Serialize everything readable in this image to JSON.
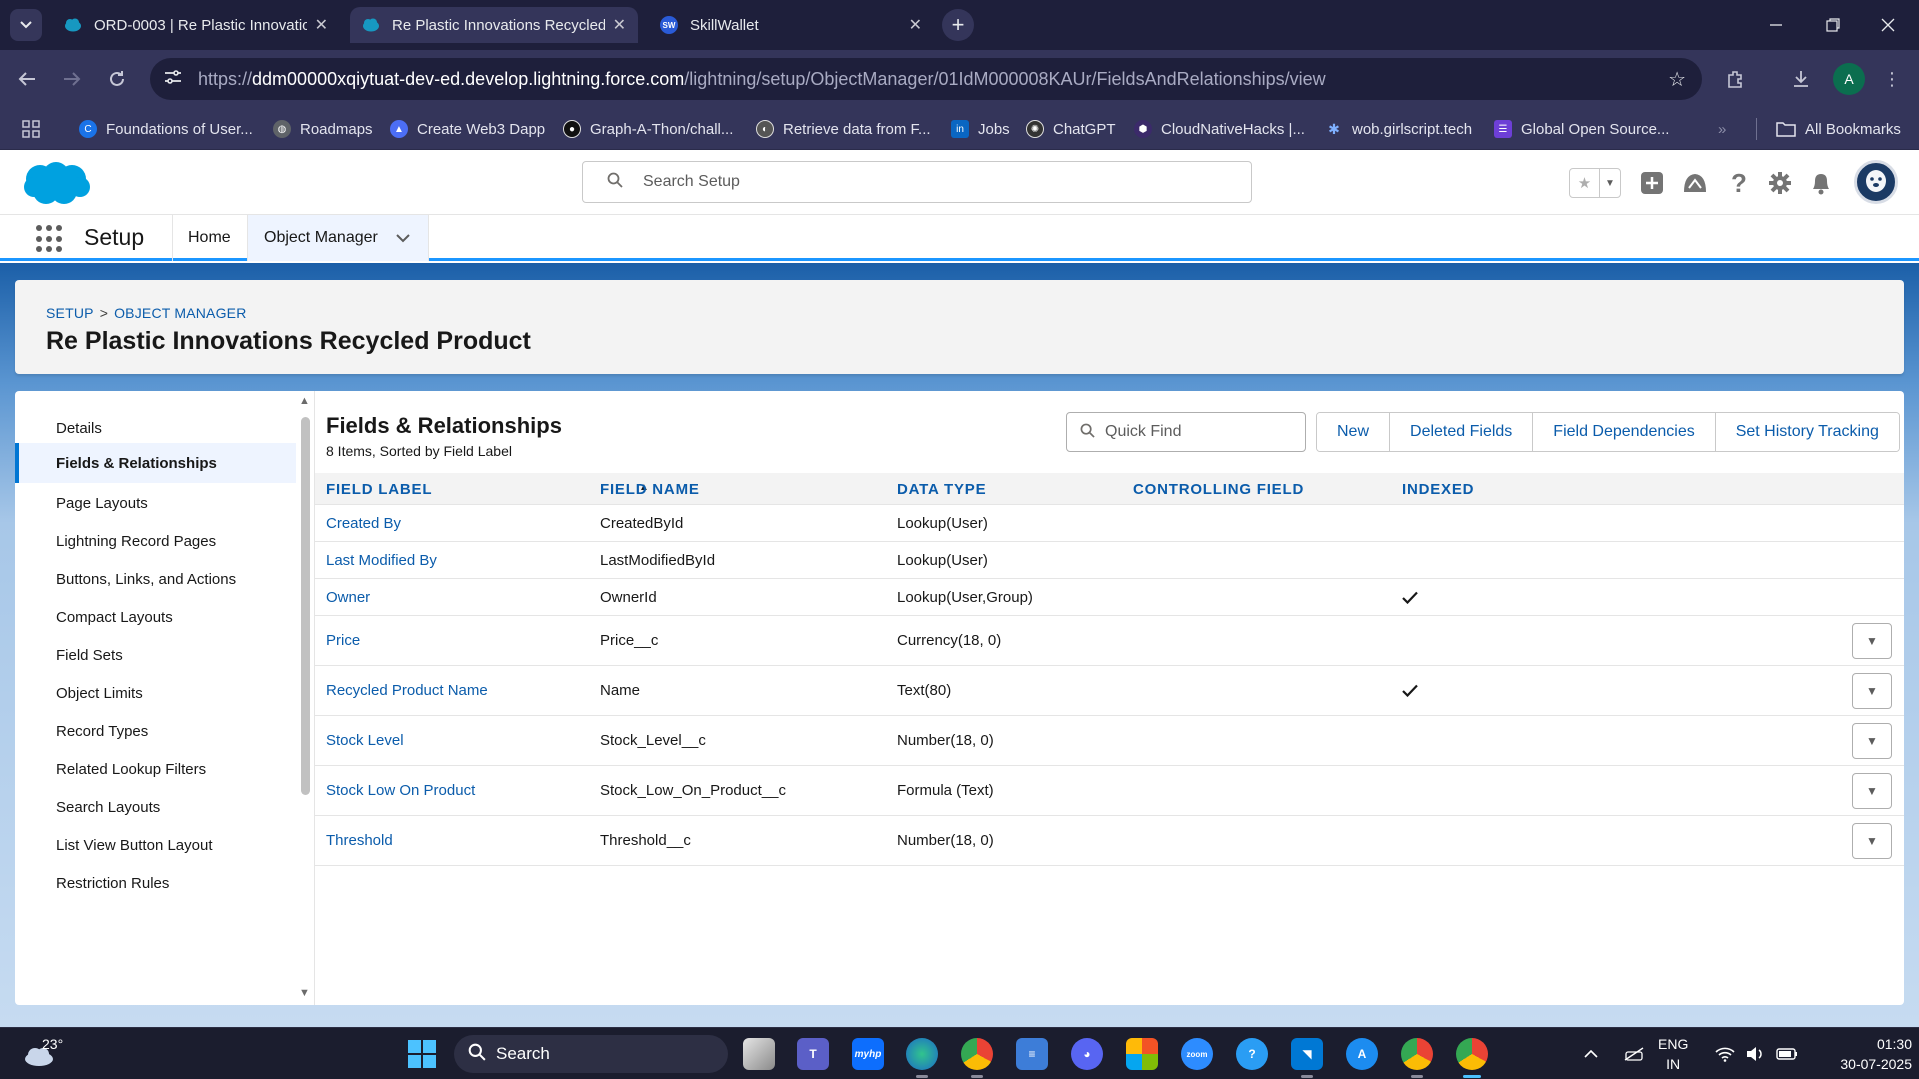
{
  "browser": {
    "tabs": [
      {
        "title": "ORD-0003 | Re Plastic Innovatio",
        "active": false
      },
      {
        "title": "Re Plastic Innovations Recycled",
        "active": true
      },
      {
        "title": "SkillWallet",
        "active": false,
        "badge": "SW"
      }
    ],
    "url_prefix": "https://",
    "url_domain": "ddm00000xqiytuat-dev-ed.develop.lightning.force.com",
    "url_path": "/lightning/setup/ObjectManager/01IdM000008KAUr/FieldsAndRelationships/view",
    "profile_initial": "A",
    "bookmarks": [
      {
        "label": "Foundations of User...",
        "icon": "c-logo-icon",
        "color": "#1a73e8"
      },
      {
        "label": "Roadmaps",
        "icon": "globe-icon",
        "color": "#5f6368"
      },
      {
        "label": "Create Web3 Dapp",
        "icon": "triangle-logo-icon",
        "color": "#4c6ef5"
      },
      {
        "label": "Graph-A-Thon/chall...",
        "icon": "github-icon",
        "color": "#111111"
      },
      {
        "label": "Retrieve data from F...",
        "icon": "circle-logo-icon",
        "color": "#555555"
      },
      {
        "label": "Jobs",
        "icon": "linkedin-icon",
        "color": "#0a66c2"
      },
      {
        "label": "ChatGPT",
        "icon": "openai-icon",
        "color": "#333333"
      },
      {
        "label": "CloudNativeHacks |...",
        "icon": "hex-logo-icon",
        "color": "#3b2a6a"
      },
      {
        "label": "wob.girlscript.tech",
        "icon": "star-logo-icon",
        "color": "#3a7bd5"
      },
      {
        "label": "Global Open Source...",
        "icon": "grid-logo-icon",
        "color": "#6d3fd6"
      }
    ],
    "all_bookmarks": "All Bookmarks"
  },
  "sf": {
    "search_placeholder": "Search Setup",
    "app_name": "Setup",
    "nav": {
      "home": "Home",
      "object_manager": "Object Manager"
    }
  },
  "record": {
    "breadcrumb": {
      "setup": "SETUP",
      "sep": ">",
      "object_manager": "OBJECT MANAGER"
    },
    "title": "Re Plastic Innovations Recycled Product"
  },
  "side_nav": [
    "Details",
    "Fields & Relationships",
    "Page Layouts",
    "Lightning Record Pages",
    "Buttons, Links, and Actions",
    "Compact Layouts",
    "Field Sets",
    "Object Limits",
    "Record Types",
    "Related Lookup Filters",
    "Search Layouts",
    "List View Button Layout",
    "Restriction Rules"
  ],
  "side_nav_active": "Fields & Relationships",
  "panel": {
    "title": "Fields & Relationships",
    "subtitle": "8 Items, Sorted by Field Label",
    "quick_find_placeholder": "Quick Find",
    "buttons": {
      "new": "New",
      "deleted_fields": "Deleted Fields",
      "field_dependencies": "Field Dependencies",
      "set_history_tracking": "Set History Tracking"
    }
  },
  "table": {
    "columns": {
      "field_label": "FIELD LABEL",
      "field_name": "FIELD NAME",
      "data_type": "DATA TYPE",
      "controlling_field": "CONTROLLING FIELD",
      "indexed": "INDEXED"
    },
    "sort": "ascending",
    "rows": [
      {
        "label": "Created By",
        "name": "CreatedById",
        "type": "Lookup(User)",
        "controlling": "",
        "indexed": false,
        "menu": false
      },
      {
        "label": "Last Modified By",
        "name": "LastModifiedById",
        "type": "Lookup(User)",
        "controlling": "",
        "indexed": false,
        "menu": false
      },
      {
        "label": "Owner",
        "name": "OwnerId",
        "type": "Lookup(User,Group)",
        "controlling": "",
        "indexed": true,
        "menu": false
      },
      {
        "label": "Price",
        "name": "Price__c",
        "type": "Currency(18, 0)",
        "controlling": "",
        "indexed": false,
        "menu": true
      },
      {
        "label": "Recycled Product Name",
        "name": "Name",
        "type": "Text(80)",
        "controlling": "",
        "indexed": true,
        "menu": true
      },
      {
        "label": "Stock Level",
        "name": "Stock_Level__c",
        "type": "Number(18, 0)",
        "controlling": "",
        "indexed": false,
        "menu": true
      },
      {
        "label": "Stock Low On Product",
        "name": "Stock_Low_On_Product__c",
        "type": "Formula (Text)",
        "controlling": "",
        "indexed": false,
        "menu": true
      },
      {
        "label": "Threshold",
        "name": "Threshold__c",
        "type": "Number(18, 0)",
        "controlling": "",
        "indexed": false,
        "menu": true
      }
    ]
  },
  "taskbar": {
    "temperature": "23°",
    "search_label": "Search",
    "lang_line1": "ENG",
    "lang_line2": "IN",
    "time": "01:30",
    "date": "30-07-2025"
  },
  "colors": {
    "sf_blue": "#0176d3",
    "link": "#0b5cab",
    "chrome_dark": "#1e1f3b",
    "chrome_toolbar": "#34355a"
  }
}
